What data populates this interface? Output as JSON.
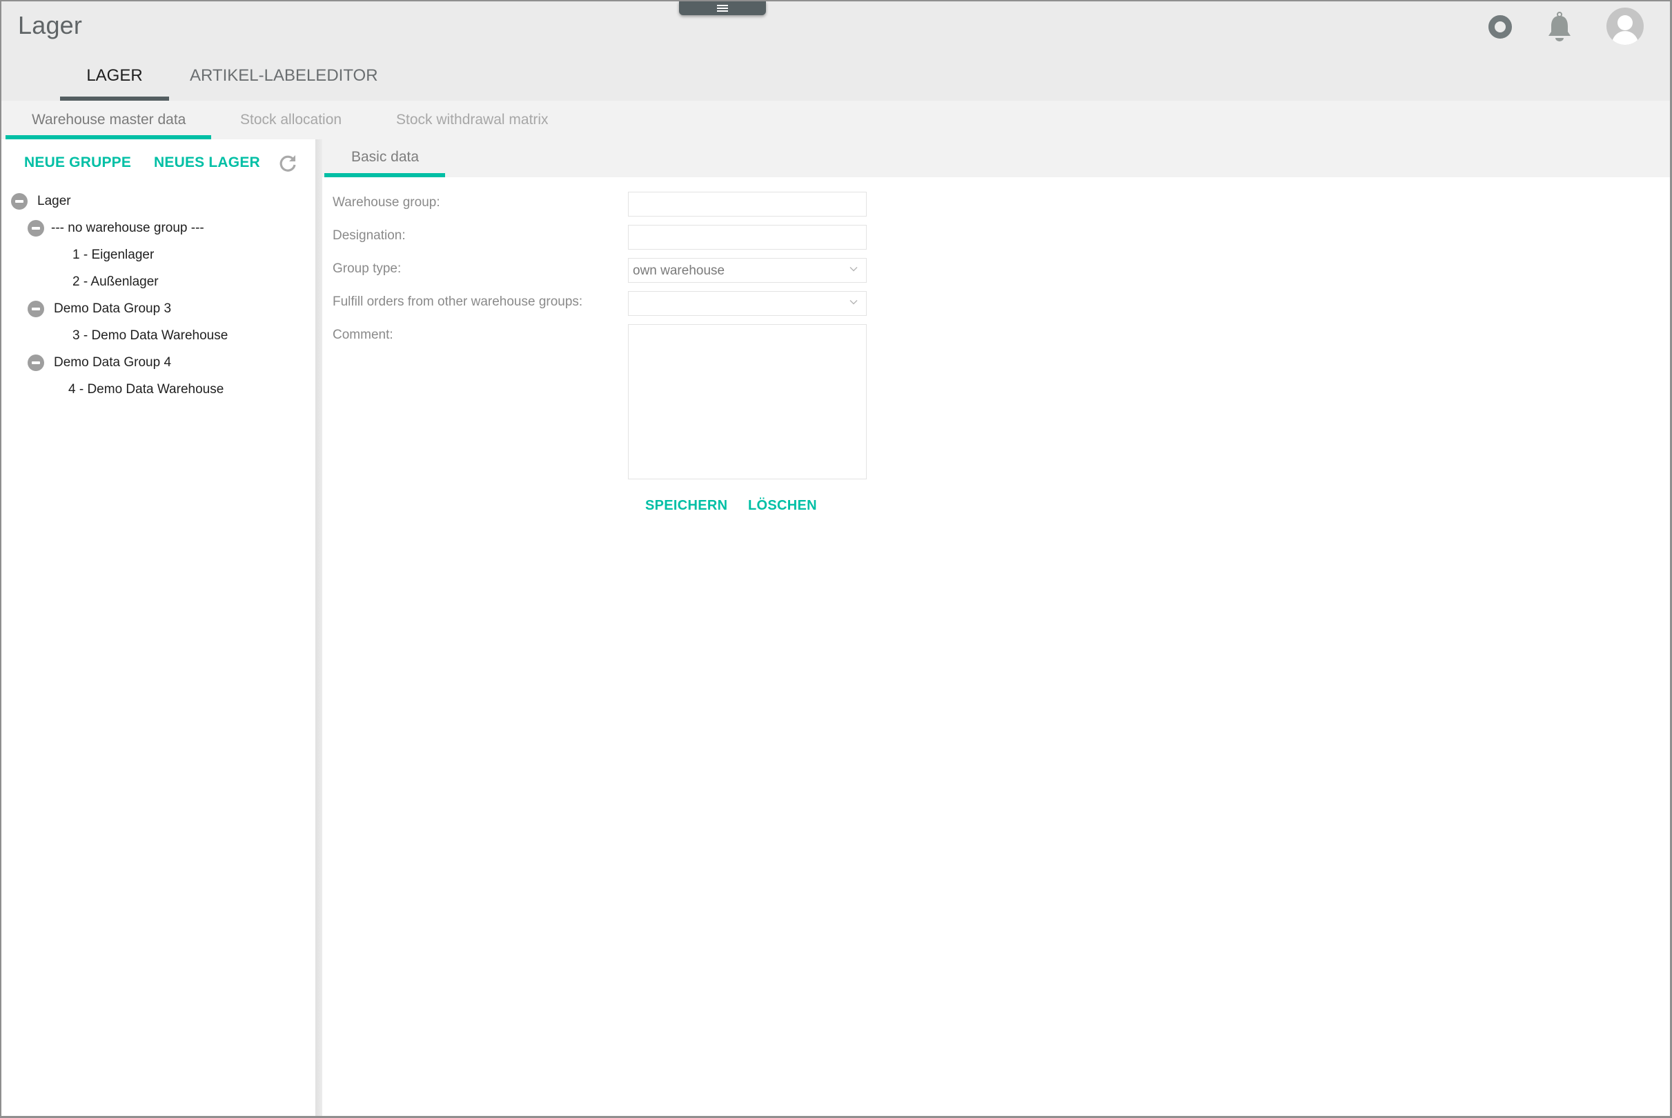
{
  "header": {
    "title": "Lager",
    "menu_icon": "hamburger-menu-icon",
    "status_icon": "ring-icon",
    "notifications_icon": "bell-icon",
    "user_icon": "avatar-icon"
  },
  "main_tabs": [
    {
      "label": "LAGER",
      "active": true
    },
    {
      "label": "ARTIKEL-LABELEDITOR",
      "active": false
    }
  ],
  "sub_tabs": [
    {
      "label": "Warehouse master data",
      "active": true
    },
    {
      "label": "Stock allocation",
      "active": false
    },
    {
      "label": "Stock withdrawal matrix",
      "active": false
    }
  ],
  "left_panel": {
    "new_group_label": "NEUE GRUPPE",
    "new_warehouse_label": "NEUES LAGER",
    "refresh_icon": "refresh-icon",
    "tree": [
      {
        "label": "Lager",
        "level": 0,
        "expandable": true
      },
      {
        "label": "--- no warehouse group ---",
        "level": 1,
        "expandable": true
      },
      {
        "label": "1 - Eigenlager",
        "level": 2,
        "expandable": false
      },
      {
        "label": "2 - Außenlager",
        "level": 2,
        "expandable": false
      },
      {
        "label": "Demo Data Group 3",
        "level": 1,
        "expandable": true
      },
      {
        "label": "3 - Demo Data Warehouse",
        "level": 2,
        "expandable": false
      },
      {
        "label": "Demo Data Group 4",
        "level": 1,
        "expandable": true
      },
      {
        "label": "4 - Demo Data Warehouse",
        "level": 2,
        "expandable": false
      }
    ]
  },
  "detail": {
    "tab_label": "Basic data",
    "fields": {
      "warehouse_group": {
        "label": "Warehouse group:",
        "value": ""
      },
      "designation": {
        "label": "Designation:",
        "value": ""
      },
      "group_type": {
        "label": "Group type:",
        "value": "own warehouse"
      },
      "fulfill_orders": {
        "label": "Fulfill orders from other warehouse groups:",
        "value": ""
      },
      "comment": {
        "label": "Comment:",
        "value": ""
      }
    },
    "save_label": "SPEICHERN",
    "delete_label": "LÖSCHEN"
  },
  "colors": {
    "accent": "#00bfa5",
    "header_bg": "#ebebeb",
    "tab_indicator": "#545e61"
  }
}
